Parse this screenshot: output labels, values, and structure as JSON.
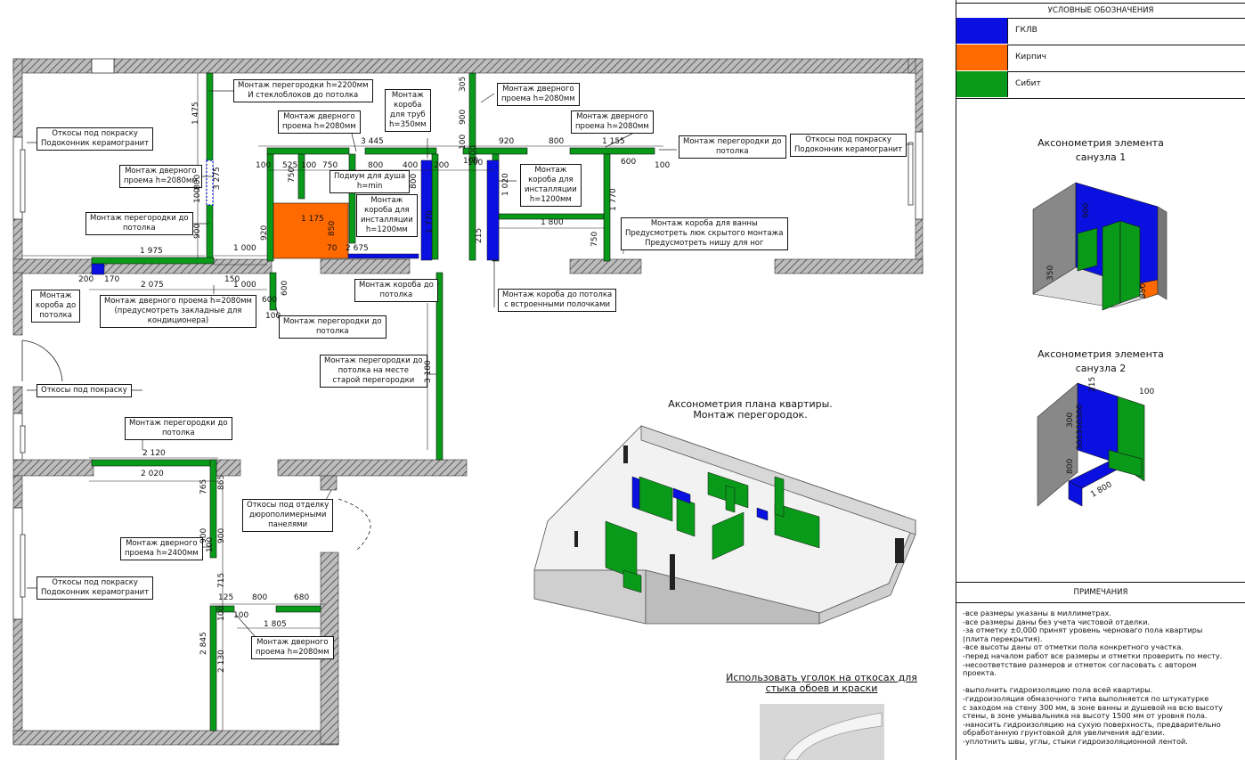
{
  "colors": {
    "gklv": "#0a10e0",
    "brick": "#ff6a00",
    "sibit": "#0a9a1a",
    "wall": "#8a8a8a",
    "hatch": "#555555"
  },
  "legend": {
    "title": "УСЛОВНЫЕ ОБОЗНАЧЕНИЯ",
    "items": [
      {
        "label": "ГКЛВ",
        "color": "#0a10e0"
      },
      {
        "label": "Кирпич",
        "color": "#ff6a00"
      },
      {
        "label": "Сибит",
        "color": "#0a9a1a"
      }
    ],
    "axo1_title": "Аксонометрия элемента\nсанузла 1",
    "axo1_dims": {
      "a": "900",
      "b": "350",
      "c": "850"
    },
    "axo2_title": "Аксонометрия элемента\nсанузла 2",
    "axo2_dims": {
      "a": "215",
      "b": "100",
      "c": "800",
      "d": "1 800",
      "e": "300",
      "f": "300300300"
    },
    "notes_title": "ПРИМЕЧАНИЯ",
    "notes": "-все размеры указаны в миллиметрах.\n-все размеры даны без учета чистовой отделки.\n-за отметку ±0,000 принят уровень черноваго пола квартиры\n(плита перекрытия).\n-все высоты даны от отметки пола конкретного участка.\n-перед началом работ все размеры и отметки проверить по месту.\n-несоответствие размеров и отметок согласовать с автором\nпроекта.\n\n-выполнить гидроизоляцию пола всей квартиры.\n-гидроизоляция обмазочного типа выполняется по штукатурке\nс заходом на стену 300 мм, в зоне ванны и душевой на всю высоту\nстены, в зоне умывальника на высоту 1500 мм от уровня пола.\n-наносить гидроизоляцию на сухую поверхность, предварительно\nобработанную грунтовкой для увеличения адгезии.\n-уплотнить швы, углы, стыки гидроизоляционной лентой."
  },
  "plan": {
    "axo_title": "Аксонометрия плана квартиры.\nМонтаж перегородок.",
    "corner_note": "Использовать уголок на откосах для\nстыка обоев и краски",
    "callouts": [
      "Монтаж перегородки h=2200мм\nИ стеклоблоков до потолка",
      "Монтаж\nкороба\nдля труб\nh=350мм",
      "Монтаж дверного\nпроема h=2080мм",
      "Монтаж дверного\nпроема h=2080мм",
      "Монтаж дверного\nпроема h=2080мм",
      "Монтаж перегородки до\nпотолка",
      "Откосы под покраску\nПодоконник керамогранит",
      "Откосы под покраску\nПодоконник керамогранит",
      "Монтаж дверного\nпроема h=2080мм",
      "Подиум для душа\nh=min",
      "Монтаж\nкороба для\nинсталляции\nh=1200мм",
      "Монтаж\nкороба для\nинсталляции\nh=1200мм",
      "Монтаж перегородки до\nпотолка",
      "Монтаж короба для ванны\nПредусмотреть люк скрытого монтажа\nПредусмотреть нишу для ног",
      "Монтаж\nкороба до\nпотолка",
      "Монтаж дверного проема h=2080мм\n(предусмотреть закладные для\nкондиционера)",
      "Монтаж короба до\nпотолка",
      "Монтаж короба до потолка\nс встроенными полочками",
      "Монтаж перегородки до\nпотолка",
      "Монтаж перегородки до\nпотолка на месте\nстарой перегородки",
      "Откосы под покраску",
      "Монтаж перегородки до\nпотолка",
      "Откосы под отделку\nдюрополимерными\nпанелями",
      "Монтаж дверного\nпроема h=2400мм",
      "Откосы под покраску\nПодоконник керамогранит",
      "Монтаж дверного\nпроема h=2080мм",
      "Откосы под покраску\nПодоконник керамогранит"
    ],
    "dims_h": [
      "3 445",
      "920",
      "800",
      "1 155",
      "525",
      "100",
      "750",
      "800",
      "400",
      "200",
      "600",
      "1 175",
      "2 675",
      "1 800",
      "1 975",
      "1 000",
      "1 000",
      "2 075",
      "2 120",
      "2 020",
      "800",
      "680",
      "1 805",
      "200",
      "170",
      "150",
      "100",
      "100",
      "100",
      "100",
      "100",
      "125",
      "100",
      "600",
      "70"
    ],
    "dims_v": [
      "1 475",
      "3 275",
      "900",
      "800",
      "100",
      "920",
      "850",
      "750",
      "800",
      "1 770",
      "1 020",
      "1 770",
      "215",
      "750",
      "100",
      "900",
      "305",
      "600",
      "100",
      "3 180",
      "765",
      "865",
      "900",
      "900",
      "715",
      "100",
      "2 845",
      "2 130",
      "100"
    ]
  }
}
